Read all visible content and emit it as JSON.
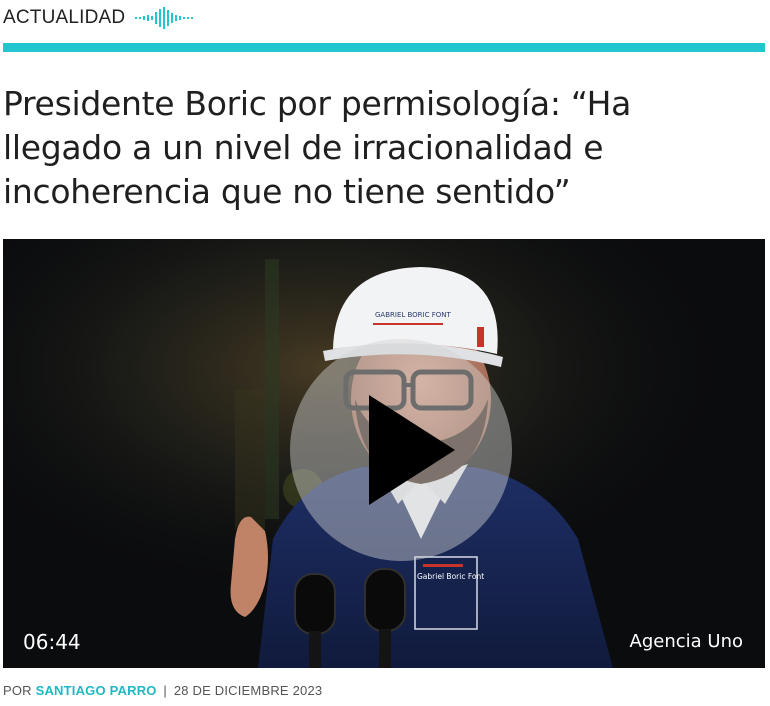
{
  "section": {
    "label": "ACTUALIDAD",
    "icon": "audio-wave-icon",
    "accent_color": "#21c6cf"
  },
  "article": {
    "headline": "Presidente Boric por permisología: “Ha llegado a un nivel de irracionalidad e incoherencia que no tiene sentido”"
  },
  "video": {
    "duration": "06:44",
    "credit": "Agencia Uno",
    "play_icon": "play-icon",
    "helmet_text": "GABRIEL BORIC FONT",
    "jacket_text": "Gabriel Boric Font"
  },
  "byline": {
    "prefix": "POR",
    "author": "SANTIAGO PARRO",
    "separator": "|",
    "date": "28 DE DICIEMBRE 2023"
  }
}
